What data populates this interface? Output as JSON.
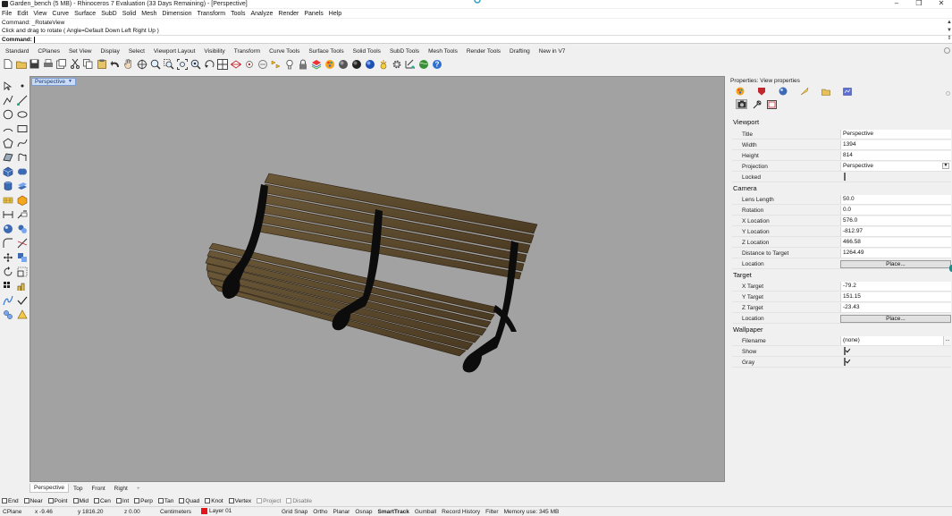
{
  "window": {
    "title": "Garden_bench (5 MB) - Rhinoceros 7 Evaluation (33 Days Remaining) - [Perspective]",
    "controls": [
      "minimize",
      "maximize",
      "close"
    ]
  },
  "menubar": [
    "File",
    "Edit",
    "View",
    "Curve",
    "Surface",
    "SubD",
    "Solid",
    "Mesh",
    "Dimension",
    "Transform",
    "Tools",
    "Analyze",
    "Render",
    "Panels",
    "Help"
  ],
  "command": {
    "history_1": "Command: _RotateView",
    "history_2": "Click and drag to rotate ( Angle=Default  Down  Left  Right  Up )",
    "prompt_label": "Command:",
    "value": ""
  },
  "toolbar_tabs": [
    "Standard",
    "CPlanes",
    "Set View",
    "Display",
    "Select",
    "Viewport Layout",
    "Visibility",
    "Transform",
    "Curve Tools",
    "Surface Tools",
    "Solid Tools",
    "SubD Tools",
    "Mesh Tools",
    "Render Tools",
    "Drafting",
    "New in V7"
  ],
  "viewport": {
    "label": "Perspective",
    "background": "#a2a2a2",
    "tabs": [
      "Perspective",
      "Top",
      "Front",
      "Right"
    ],
    "add_tab": "+"
  },
  "osnaps": [
    {
      "label": "End",
      "checked": false
    },
    {
      "label": "Near",
      "checked": false
    },
    {
      "label": "Point",
      "checked": false
    },
    {
      "label": "Mid",
      "checked": false
    },
    {
      "label": "Cen",
      "checked": false
    },
    {
      "label": "Int",
      "checked": false
    },
    {
      "label": "Perp",
      "checked": false
    },
    {
      "label": "Tan",
      "checked": false
    },
    {
      "label": "Quad",
      "checked": false
    },
    {
      "label": "Knot",
      "checked": false
    },
    {
      "label": "Vertex",
      "checked": false
    },
    {
      "label": "Project",
      "checked": false,
      "disabled": true
    },
    {
      "label": "Disable",
      "checked": false,
      "disabled": true
    }
  ],
  "statusbar": {
    "cplane": "CPlane",
    "x": "x -9.46",
    "y": "y 1816.20",
    "z": "z 0.00",
    "units": "Centimeters",
    "layer": "Layer 01",
    "layer_color": "#e3171b",
    "toggles": [
      "Grid Snap",
      "Ortho",
      "Planar",
      "Osnap",
      "SmartTrack",
      "Gumball",
      "Record History",
      "Filter"
    ],
    "smarttrack_on": "SmartTrack",
    "memory": "Memory use: 345 MB"
  },
  "properties": {
    "title": "Properties: View properties",
    "viewport_section": "Viewport",
    "title_label": "Title",
    "title_value": "Perspective",
    "width_label": "Width",
    "width_value": "1394",
    "height_label": "Height",
    "height_value": "814",
    "projection_label": "Projection",
    "projection_value": "Perspective",
    "locked_label": "Locked",
    "locked": false,
    "camera_section": "Camera",
    "lens_label": "Lens Length",
    "lens_value": "50.0",
    "rotation_label": "Rotation",
    "rotation_value": "0.0",
    "xloc_label": "X Location",
    "xloc_value": "576.0",
    "yloc_label": "Y Location",
    "yloc_value": "-812.97",
    "zloc_label": "Z Location",
    "zloc_value": "466.58",
    "dist_label": "Distance to Target",
    "dist_value": "1264.49",
    "location_label": "Location",
    "place_button": "Place...",
    "target_section": "Target",
    "xtarget_label": "X Target",
    "xtarget_value": "-79.2",
    "ytarget_label": "Y Target",
    "ytarget_value": "151.15",
    "ztarget_label": "Z Target",
    "ztarget_value": "-23.43",
    "target_location_label": "Location",
    "target_place_button": "Place...",
    "wallpaper_section": "Wallpaper",
    "filename_label": "Filename",
    "filename_value": "(none)",
    "filename_button": "...",
    "show_label": "Show",
    "show": true,
    "gray_label": "Gray",
    "gray": true
  }
}
